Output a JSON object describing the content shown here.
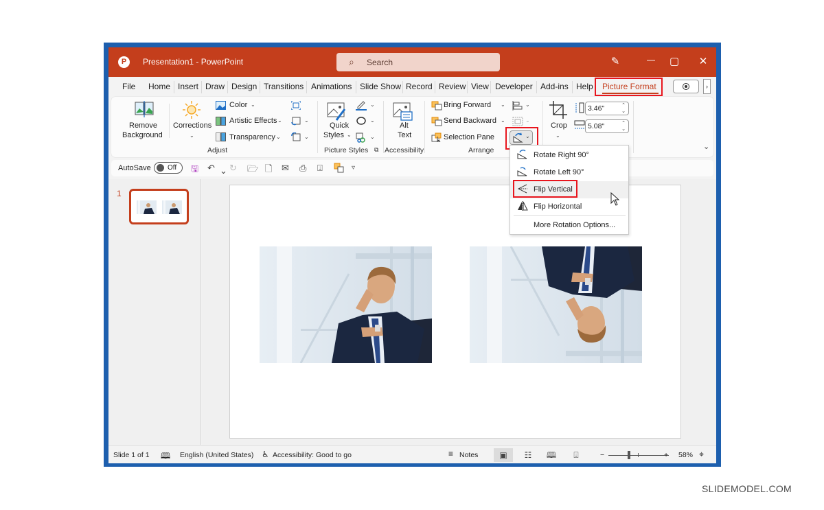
{
  "window": {
    "title": "Presentation1  -  PowerPoint",
    "app_logo": "P",
    "search_placeholder": "Search",
    "controls": {
      "pen_icon": "✎",
      "minimize": "—",
      "maximize": "▢",
      "close": "✕"
    }
  },
  "menu": {
    "tabs": [
      "File",
      "Home",
      "Insert",
      "Draw",
      "Design",
      "Transitions",
      "Animations",
      "Slide Show",
      "Record",
      "Review",
      "View",
      "Developer",
      "Add-ins",
      "Help",
      "Picture Format"
    ],
    "active_tab": "Picture Format",
    "more_tabs": "›"
  },
  "ribbon": {
    "adjust": {
      "remove_background": [
        "Remove",
        "Background"
      ],
      "corrections": "Corrections",
      "color": "Color",
      "artistic_effects": "Artistic Effects",
      "transparency": "Transparency",
      "group_label": "Adjust"
    },
    "picture_styles": {
      "quick_styles": [
        "Quick",
        "Styles"
      ],
      "group_label": "Picture Styles"
    },
    "accessibility": {
      "alt_text": [
        "Alt",
        "Text"
      ],
      "group_label": "Accessibility"
    },
    "arrange": {
      "bring_forward": "Bring Forward",
      "send_backward": "Send Backward",
      "selection_pane": "Selection Pane",
      "group_label": "Arrange"
    },
    "size": {
      "crop": "Crop",
      "height": "3.46\"",
      "width": "5.08\""
    }
  },
  "rotate_menu": {
    "items": [
      {
        "label": "Rotate Right 90°",
        "icon": "rotate-right-icon"
      },
      {
        "label": "Rotate Left 90°",
        "icon": "rotate-left-icon"
      },
      {
        "label": "Flip Vertical",
        "icon": "flip-vertical-icon",
        "highlighted": true
      },
      {
        "label": "Flip Horizontal",
        "icon": "flip-horizontal-icon"
      },
      {
        "label": "More Rotation Options...",
        "icon": ""
      }
    ]
  },
  "quick_access": {
    "autosave_label": "AutoSave",
    "autosave_state": "Off"
  },
  "thumbnails": {
    "slide_number": "1"
  },
  "status": {
    "slide_counter": "Slide 1 of 1",
    "language": "English (United States)",
    "accessibility": "Accessibility: Good to go",
    "notes": "Notes",
    "zoom_minus": "−",
    "zoom_plus": "+",
    "zoom_level": "58%"
  },
  "watermark": "SLIDEMODEL.COM",
  "colors": {
    "accent": "#c43e1c",
    "frame": "#1d5fae",
    "highlight_box": "#e8151d"
  }
}
